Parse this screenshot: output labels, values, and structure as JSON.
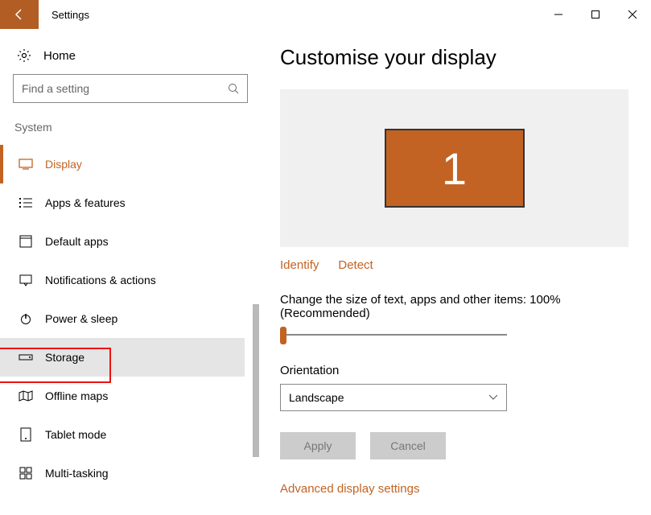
{
  "titlebar": {
    "title": "Settings"
  },
  "sidebar": {
    "home_label": "Home",
    "search_placeholder": "Find a setting",
    "category": "System",
    "items": [
      {
        "label": "Display"
      },
      {
        "label": "Apps & features"
      },
      {
        "label": "Default apps"
      },
      {
        "label": "Notifications & actions"
      },
      {
        "label": "Power & sleep"
      },
      {
        "label": "Storage"
      },
      {
        "label": "Offline maps"
      },
      {
        "label": "Tablet mode"
      },
      {
        "label": "Multi-tasking"
      }
    ]
  },
  "main": {
    "title": "Customise your display",
    "monitor_number": "1",
    "identify": "Identify",
    "detect": "Detect",
    "text_size_label": "Change the size of text, apps and other items: 100% (Recommended)",
    "orientation_label": "Orientation",
    "orientation_value": "Landscape",
    "apply": "Apply",
    "cancel": "Cancel",
    "advanced": "Advanced display settings"
  }
}
